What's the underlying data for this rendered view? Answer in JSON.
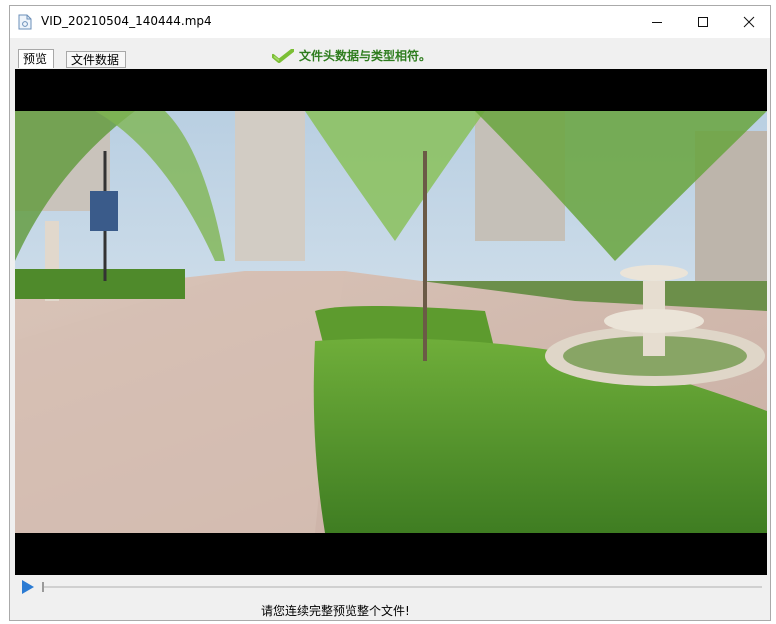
{
  "window": {
    "title": "VID_20210504_140444.mp4",
    "minimize_icon": "minimize-icon",
    "maximize_icon": "maximize-icon",
    "close_icon": "close-icon"
  },
  "tabs": [
    {
      "label": "预览",
      "active": true
    },
    {
      "label": "文件数据",
      "active": false
    }
  ],
  "status": {
    "message": "文件头数据与类型相符。",
    "color": "#2f7d1f",
    "icon": "check-icon"
  },
  "player": {
    "play_icon": "play-icon",
    "progress": 0,
    "notice": "请您连续完整预览整个文件!"
  }
}
